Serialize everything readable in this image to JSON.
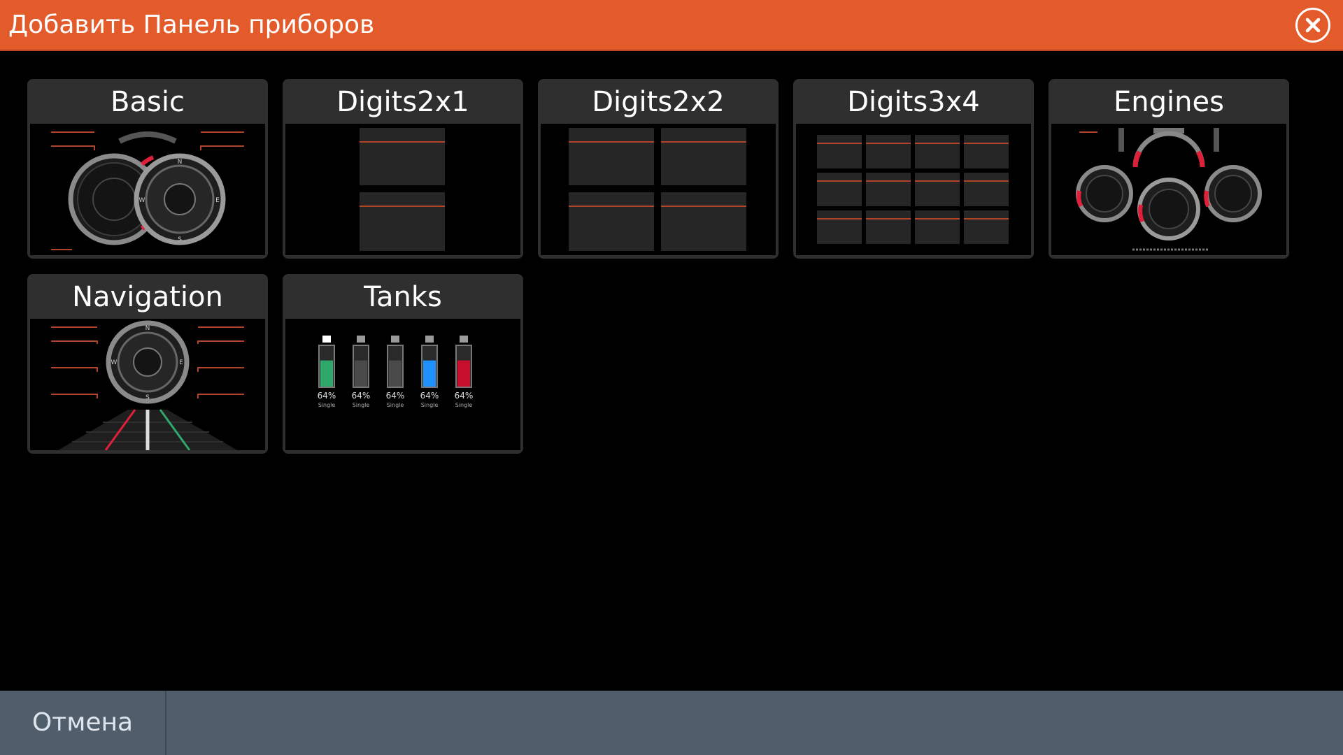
{
  "dialog": {
    "title": "Добавить Панель приборов",
    "close_icon": "close-icon"
  },
  "tiles": [
    {
      "label": "Basic"
    },
    {
      "label": "Digits2x1"
    },
    {
      "label": "Digits2x2"
    },
    {
      "label": "Digits3x4"
    },
    {
      "label": "Engines"
    },
    {
      "label": "Navigation"
    },
    {
      "label": "Tanks"
    }
  ],
  "tanks_preview": {
    "gauges": [
      {
        "value": "64",
        "unit": "%",
        "label": "Single",
        "fill_percent": 64,
        "color": "#2fa86b"
      },
      {
        "value": "64",
        "unit": "%",
        "label": "Single",
        "fill_percent": 64,
        "color": "#4a4a4a"
      },
      {
        "value": "64",
        "unit": "%",
        "label": "Single",
        "fill_percent": 64,
        "color": "#4a4a4a"
      },
      {
        "value": "64",
        "unit": "%",
        "label": "Single",
        "fill_percent": 64,
        "color": "#1e90ff"
      },
      {
        "value": "64",
        "unit": "%",
        "label": "Single",
        "fill_percent": 64,
        "color": "#c8102e"
      }
    ]
  },
  "footer": {
    "cancel_label": "Отмена"
  },
  "colors": {
    "accent": "#e35b2b",
    "footer": "#505d6b",
    "tile": "#2f2f2f",
    "divider_line": "#b0452a",
    "needle_red": "#e0203a"
  }
}
